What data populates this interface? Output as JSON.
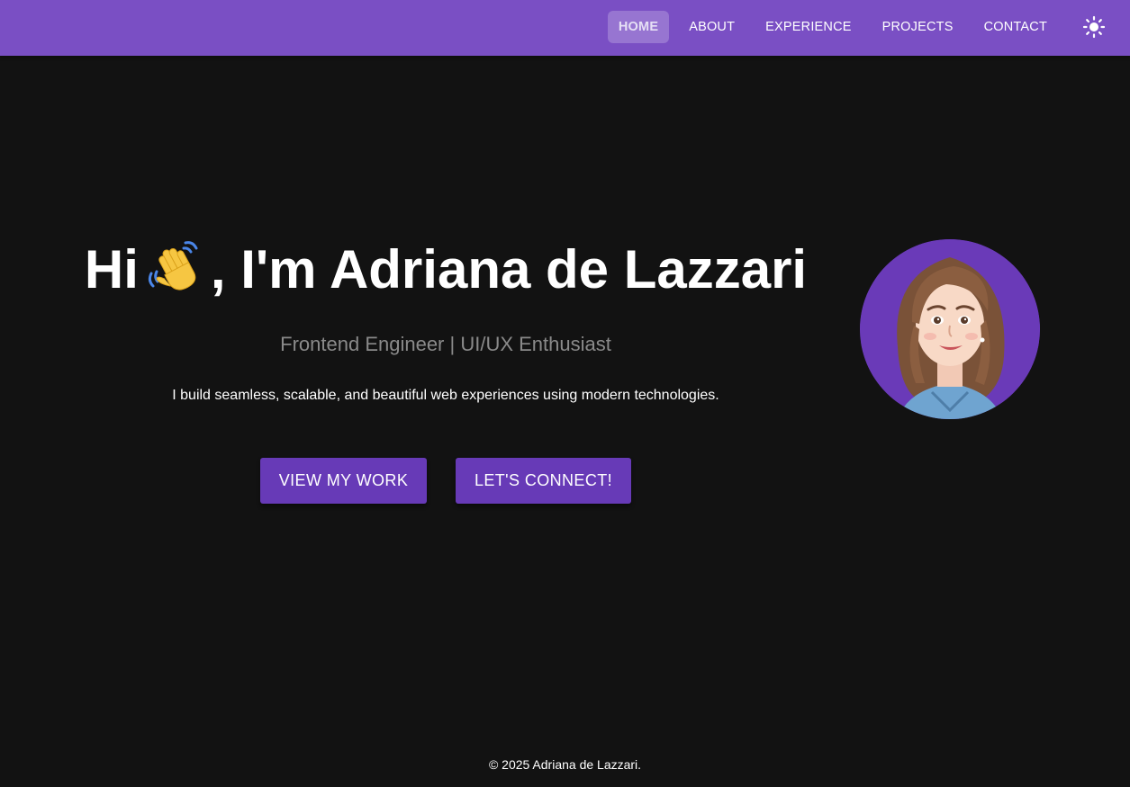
{
  "nav": {
    "items": [
      {
        "label": "HOME",
        "active": true
      },
      {
        "label": "ABOUT",
        "active": false
      },
      {
        "label": "EXPERIENCE",
        "active": false
      },
      {
        "label": "PROJECTS",
        "active": false
      },
      {
        "label": "CONTACT",
        "active": false
      }
    ],
    "theme_toggle_icon": "sun-icon"
  },
  "hero": {
    "greeting": "Hi",
    "wave_icon": "waving-hand-icon",
    "name_text": ", I'm Adriana de Lazzari",
    "subtitle": "Frontend Engineer | UI/UX Enthusiast",
    "tagline": "I build seamless, scalable, and beautiful web experiences using modern technologies.",
    "buttons": {
      "work_label": "VIEW MY WORK",
      "connect_label": "LET'S CONNECT!"
    },
    "avatar_icon": "profile-avatar-illustration"
  },
  "footer": {
    "copyright": "© 2025 Adriana de Lazzari."
  },
  "colors": {
    "nav_bg": "#7a4fc4",
    "page_bg": "#121212",
    "button_bg": "#673ab7",
    "avatar_bg": "#6a3ab8"
  }
}
